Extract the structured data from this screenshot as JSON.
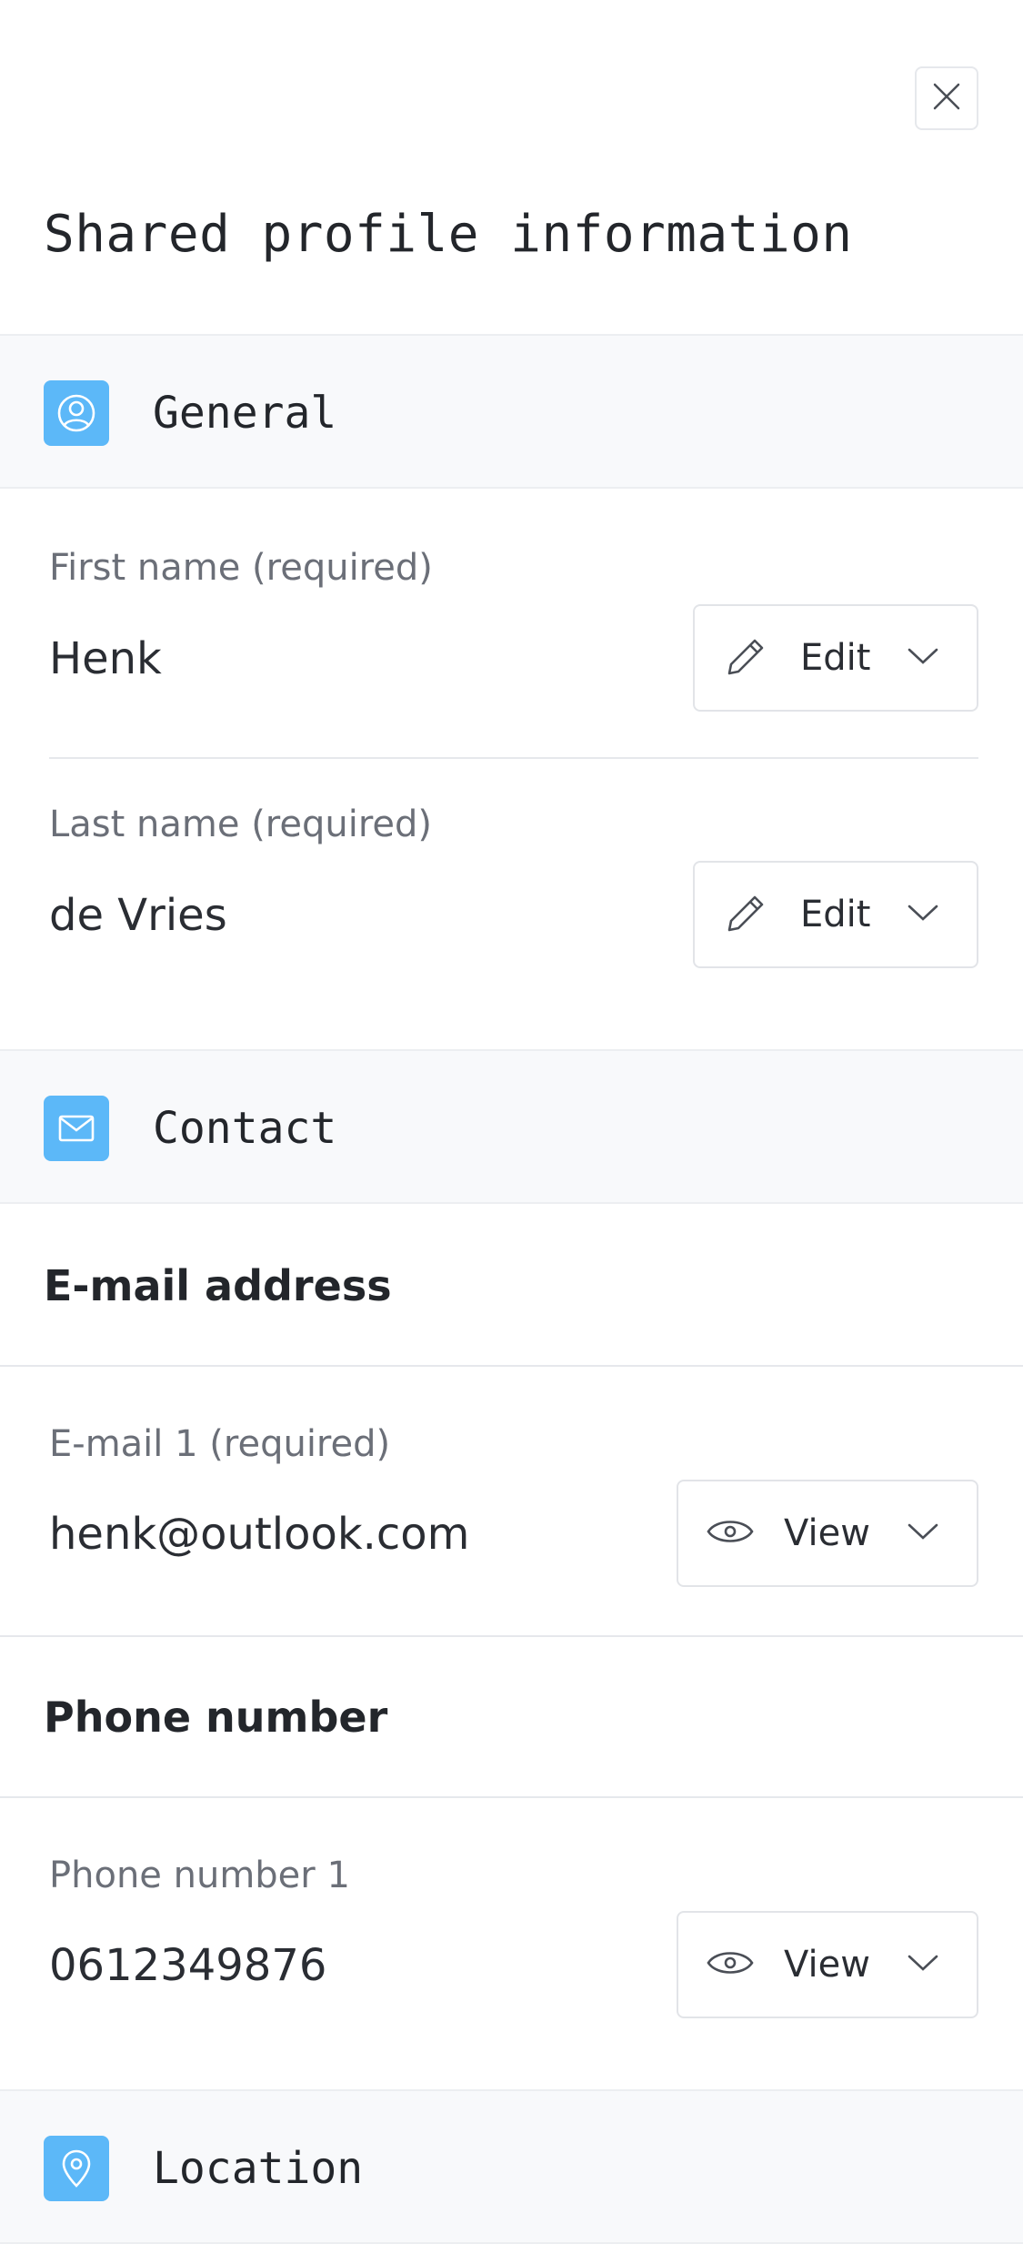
{
  "header": {
    "title": "Shared profile information",
    "close_icon": "close-icon"
  },
  "sections": {
    "general": {
      "title": "General",
      "icon": "user-circle-icon",
      "fields": [
        {
          "label": "First name (required)",
          "value": "Henk",
          "action": "Edit",
          "action_icon": "pencil-icon"
        },
        {
          "label": "Last name (required)",
          "value": "de Vries",
          "action": "Edit",
          "action_icon": "pencil-icon"
        }
      ]
    },
    "contact": {
      "title": "Contact",
      "icon": "mail-icon",
      "email": {
        "heading": "E-mail address",
        "fields": [
          {
            "label": "E-mail 1 (required)",
            "value": "henk@outlook.com",
            "action": "View",
            "action_icon": "eye-icon"
          }
        ]
      },
      "phone": {
        "heading": "Phone number",
        "fields": [
          {
            "label": "Phone number 1",
            "value": "0612349876",
            "action": "View",
            "action_icon": "eye-icon"
          }
        ]
      }
    },
    "location": {
      "title": "Location",
      "icon": "map-pin-icon"
    }
  },
  "colors": {
    "accent": "#5cb8f8",
    "section_bg": "#f8f9fb",
    "border": "#e6e8ec"
  }
}
